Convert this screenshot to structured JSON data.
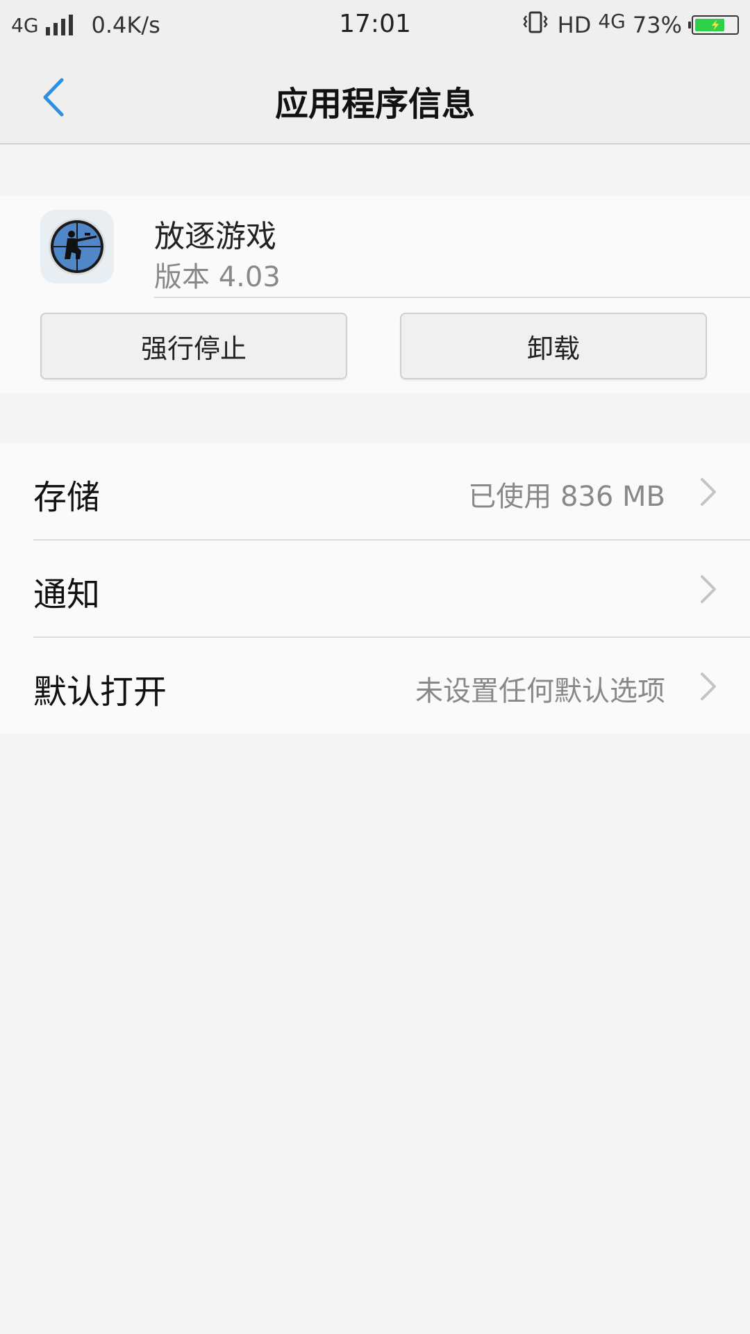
{
  "status_bar": {
    "network_type": "4G",
    "speed": "0.4K/s",
    "time": "17:01",
    "hd": "HD",
    "network_type_right": "4G",
    "battery_percent": "73%",
    "battery_level": 0.73,
    "icons": [
      "signal-icon",
      "vibrate-icon",
      "battery-icon",
      "charging-bolt-icon"
    ]
  },
  "header": {
    "title": "应用程序信息",
    "back_icon": "chevron-left-icon",
    "accent_color": "#2e8fe0"
  },
  "app": {
    "name": "放逐游戏",
    "version": "版本 4.03",
    "icon": "soldier-sniper-icon"
  },
  "actions": {
    "force_stop_label": "强行停止",
    "uninstall_label": "卸载"
  },
  "settings": {
    "items": [
      {
        "label": "存储",
        "value": "已使用 836 MB"
      },
      {
        "label": "通知",
        "value": ""
      },
      {
        "label": "默认打开",
        "value": "未设置任何默认选项"
      }
    ],
    "chevron_icon": "chevron-right-icon"
  }
}
